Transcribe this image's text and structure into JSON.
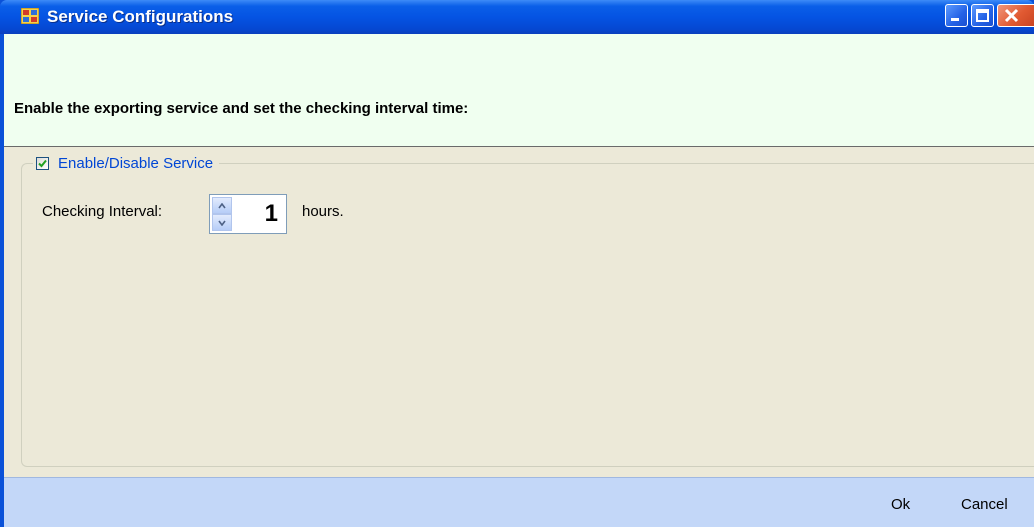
{
  "window": {
    "title": "Service Configurations",
    "app_icon": "app-window-icon",
    "controls": [
      "minimize-icon",
      "maximize-icon",
      "close-icon"
    ]
  },
  "banner": {
    "instruction": "Enable the exporting service and set the checking interval time:"
  },
  "service_group": {
    "label": "Enable/Disable Service",
    "checked": true
  },
  "interval": {
    "label": "Checking Interval:",
    "value": "1",
    "unit": "hours."
  },
  "footer": {
    "ok_label": "Ok",
    "cancel_label": "Cancel"
  },
  "colors": {
    "titlebar": "#0554e3",
    "banner_bg": "#f0fff0",
    "panel_bg": "#ece9d8",
    "footer_bg": "#c3d7f8",
    "group_label": "#0046d5"
  }
}
